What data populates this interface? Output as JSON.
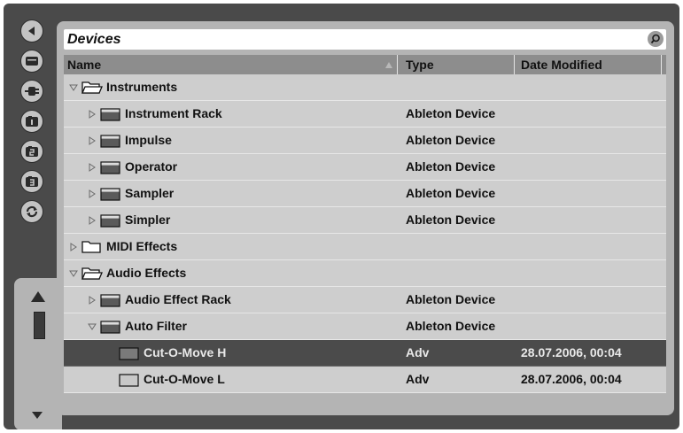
{
  "browser": {
    "title": "Devices",
    "search_icon": "search-icon"
  },
  "columns": {
    "name": "Name",
    "type": "Type",
    "date_modified": "Date Modified",
    "sort": "ascending"
  },
  "sidebar": {
    "buttons": [
      {
        "icon": "hide-browser-arrow-icon"
      },
      {
        "icon": "live-devices-icon"
      },
      {
        "icon": "plug-ins-icon"
      },
      {
        "icon": "file-browser-1-icon"
      },
      {
        "icon": "file-browser-2-icon"
      },
      {
        "icon": "file-browser-3-icon"
      },
      {
        "icon": "refresh-icon"
      }
    ],
    "scroll_up_icon": "scroll-up-arrow-icon",
    "scroll_down_icon": "scroll-down-arrow-icon"
  },
  "rows": [
    {
      "name": "Instruments",
      "type": "",
      "date": "",
      "level": 0,
      "expanded": true,
      "icon": "folder-open-icon",
      "selected": false
    },
    {
      "name": "Instrument Rack",
      "type": "Ableton Device",
      "date": "",
      "level": 1,
      "expanded": false,
      "icon": "device-icon",
      "selected": false
    },
    {
      "name": "Impulse",
      "type": "Ableton Device",
      "date": "",
      "level": 1,
      "expanded": false,
      "icon": "device-icon",
      "selected": false
    },
    {
      "name": "Operator",
      "type": "Ableton Device",
      "date": "",
      "level": 1,
      "expanded": false,
      "icon": "device-icon",
      "selected": false
    },
    {
      "name": "Sampler",
      "type": "Ableton Device",
      "date": "",
      "level": 1,
      "expanded": false,
      "icon": "device-icon",
      "selected": false
    },
    {
      "name": "Simpler",
      "type": "Ableton Device",
      "date": "",
      "level": 1,
      "expanded": false,
      "icon": "device-icon",
      "selected": false
    },
    {
      "name": "MIDI Effects",
      "type": "",
      "date": "",
      "level": 0,
      "expanded": false,
      "icon": "folder-closed-icon",
      "selected": false
    },
    {
      "name": "Audio Effects",
      "type": "",
      "date": "",
      "level": 0,
      "expanded": true,
      "icon": "folder-open-icon",
      "selected": false
    },
    {
      "name": "Audio Effect Rack",
      "type": "Ableton Device",
      "date": "",
      "level": 1,
      "expanded": false,
      "icon": "device-icon",
      "selected": false
    },
    {
      "name": "Auto Filter",
      "type": "Ableton Device",
      "date": "",
      "level": 1,
      "expanded": true,
      "icon": "device-icon",
      "selected": false
    },
    {
      "name": "Cut-O-Move H",
      "type": "Adv",
      "date": "28.07.2006, 00:04",
      "level": 2,
      "expanded": null,
      "icon": "preset-icon",
      "selected": true
    },
    {
      "name": "Cut-O-Move L",
      "type": "Adv",
      "date": "28.07.2006, 00:04",
      "level": 2,
      "expanded": null,
      "icon": "preset-icon",
      "selected": false
    }
  ]
}
